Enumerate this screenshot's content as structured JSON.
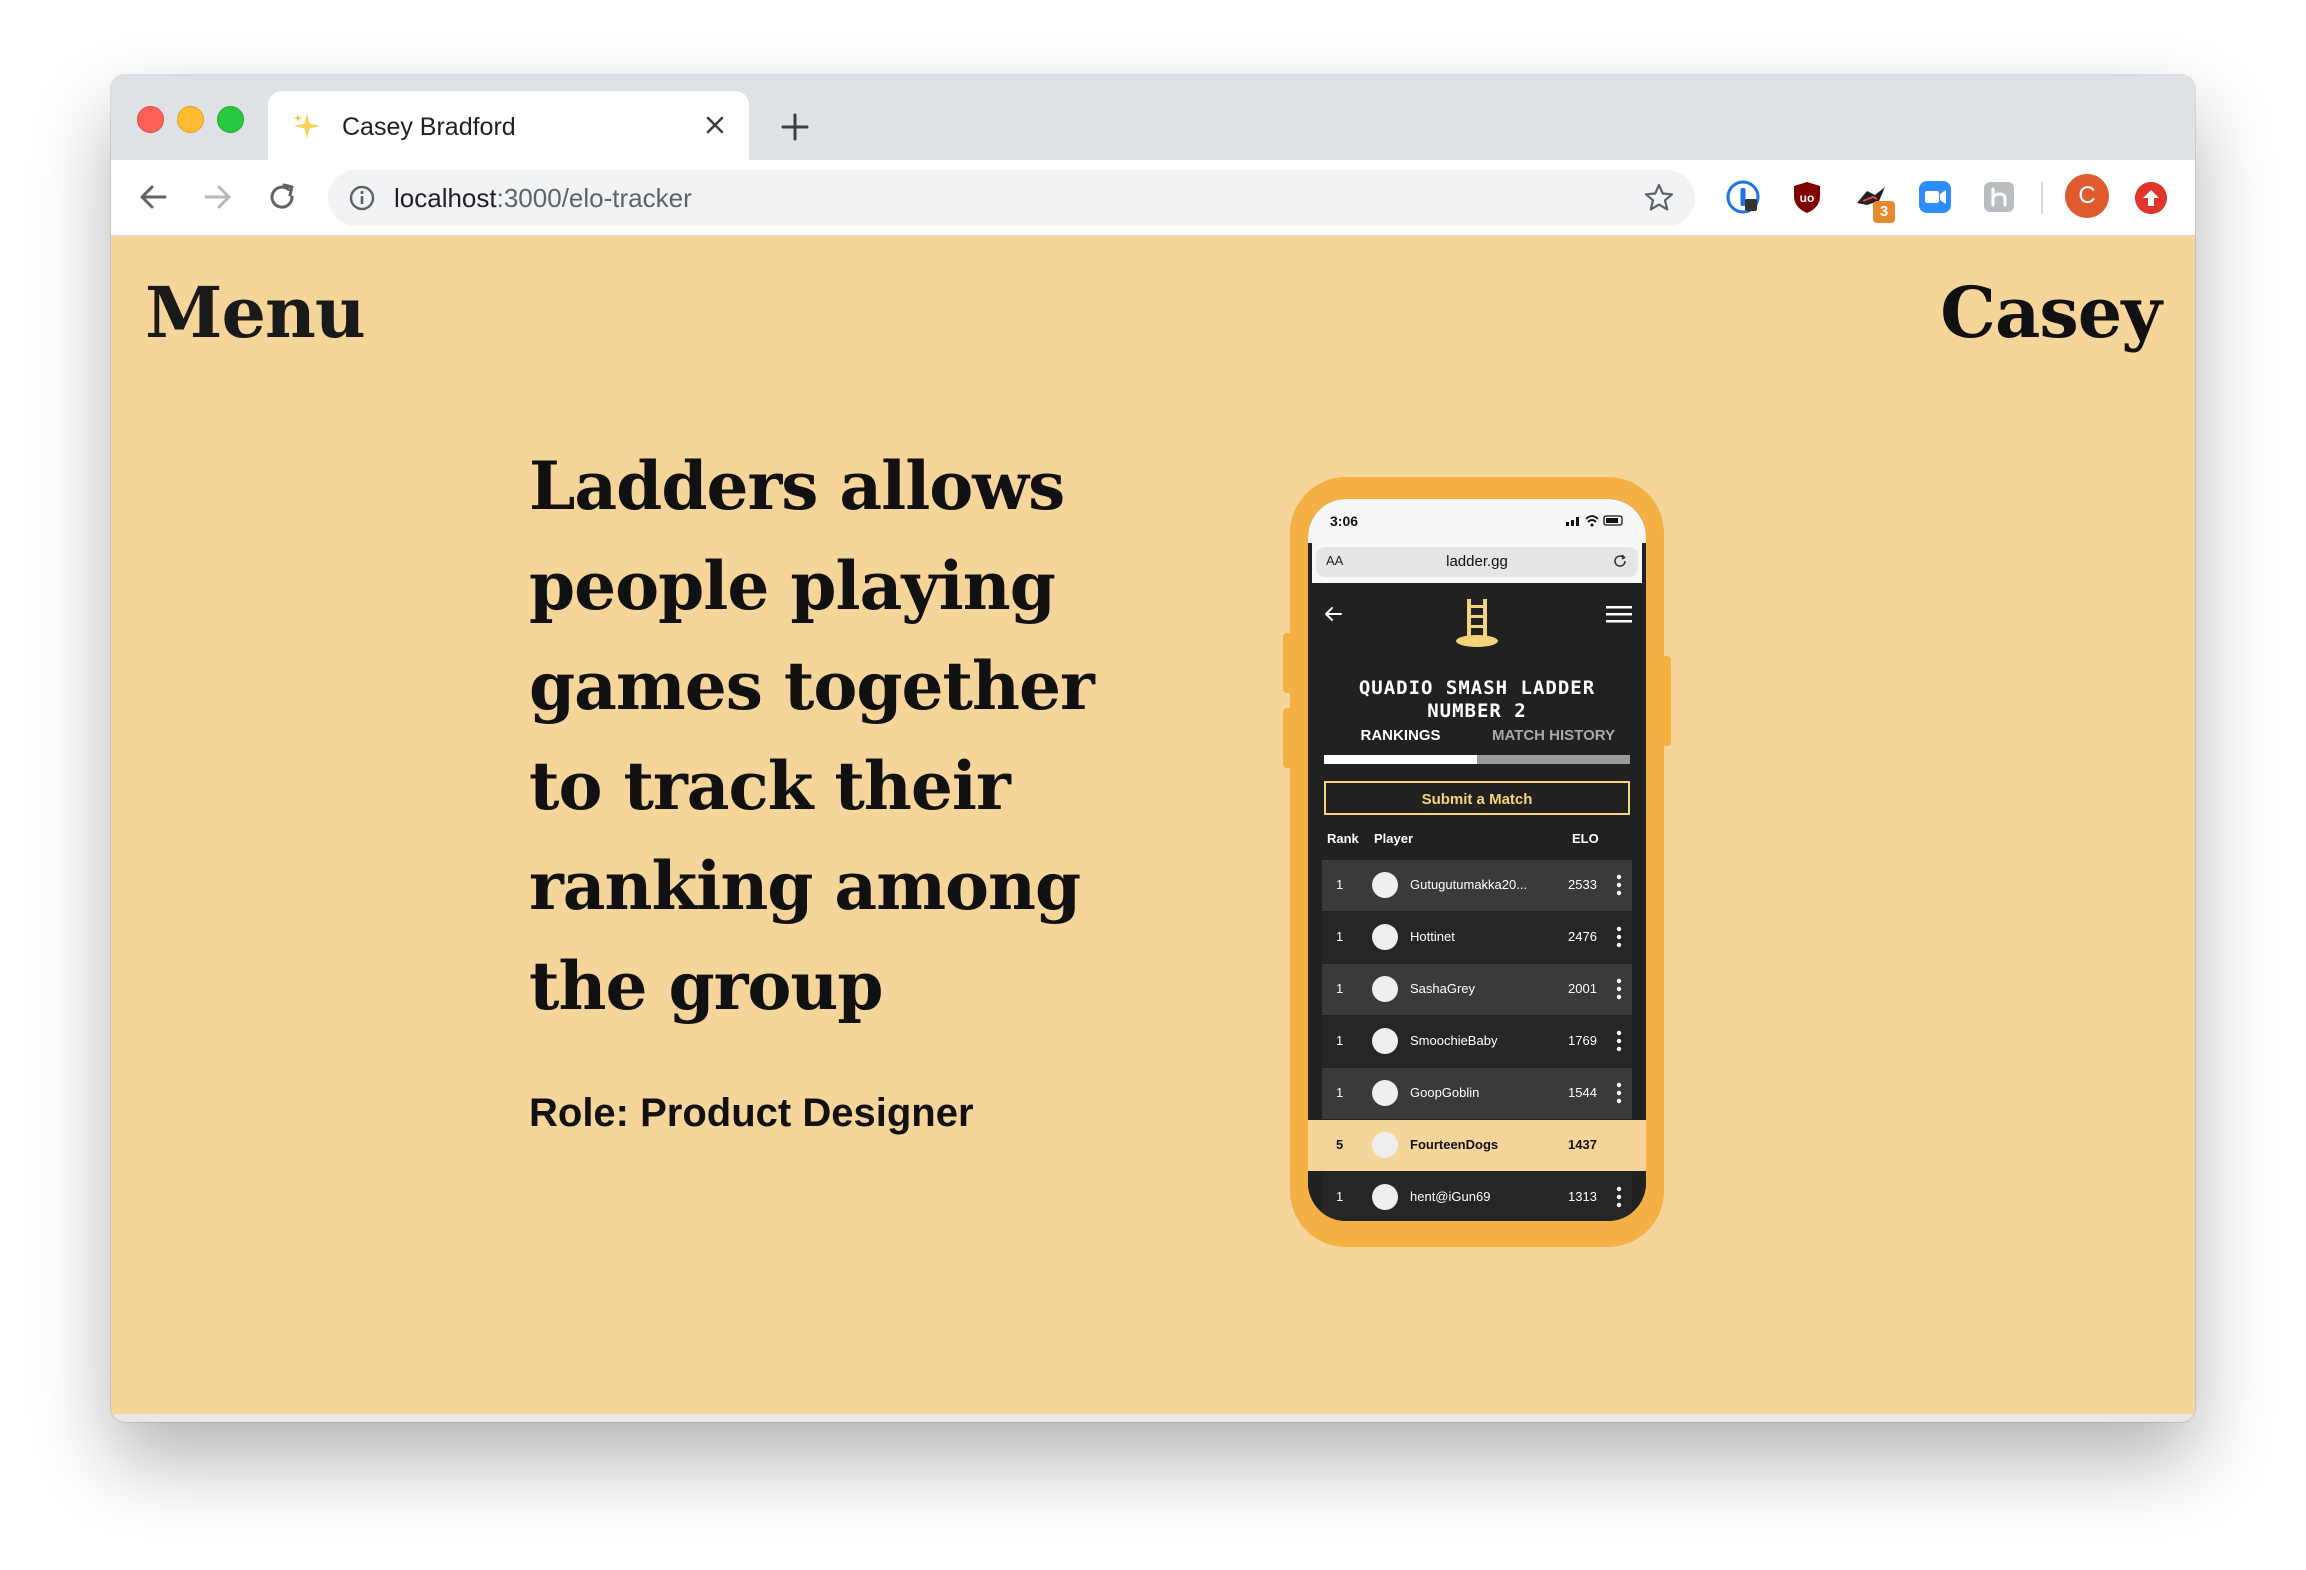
{
  "browser": {
    "tab_title": "Casey Bradford",
    "url_host": "localhost",
    "url_path": ":3000/elo-tracker",
    "extensions": [
      "1password-icon",
      "ublock-icon",
      "extension-bird-icon",
      "zoom-icon",
      "extension-gray-icon"
    ],
    "ext_badge": "3",
    "profile_initial": "C"
  },
  "page": {
    "menu_label": "Menu",
    "name_label": "Casey",
    "headline": "Ladders allows people playing games together to track their ranking among the group",
    "role": "Role: Product Designer"
  },
  "phone": {
    "time": "3:06",
    "aa": "AA",
    "url": "ladder.gg",
    "title_line1": "QUADIO SMASH LADDER",
    "title_line2": "NUMBER 2",
    "tab_rankings": "RANKINGS",
    "tab_history": "MATCH HISTORY",
    "submit_label": "Submit a Match",
    "columns": {
      "rank": "Rank",
      "player": "Player",
      "elo": "ELO"
    },
    "rows": [
      {
        "rank": "1",
        "player": "Gutugutumakka20...",
        "elo": "2533"
      },
      {
        "rank": "1",
        "player": "Hottinet",
        "elo": "2476"
      },
      {
        "rank": "1",
        "player": "SashaGrey",
        "elo": "2001"
      },
      {
        "rank": "1",
        "player": "SmoochieBaby",
        "elo": "1769"
      },
      {
        "rank": "1",
        "player": "GoopGoblin",
        "elo": "1544"
      },
      {
        "rank": "5",
        "player": "FourteenDogs",
        "elo": "1437"
      },
      {
        "rank": "1",
        "player": "hent@iGun69",
        "elo": "1313"
      }
    ],
    "colors": {
      "frame": "#f4b043",
      "accent": "#f4d37a",
      "highlight_row": "#f5d59a"
    }
  },
  "colors": {
    "page_background": "#f5d59a"
  }
}
